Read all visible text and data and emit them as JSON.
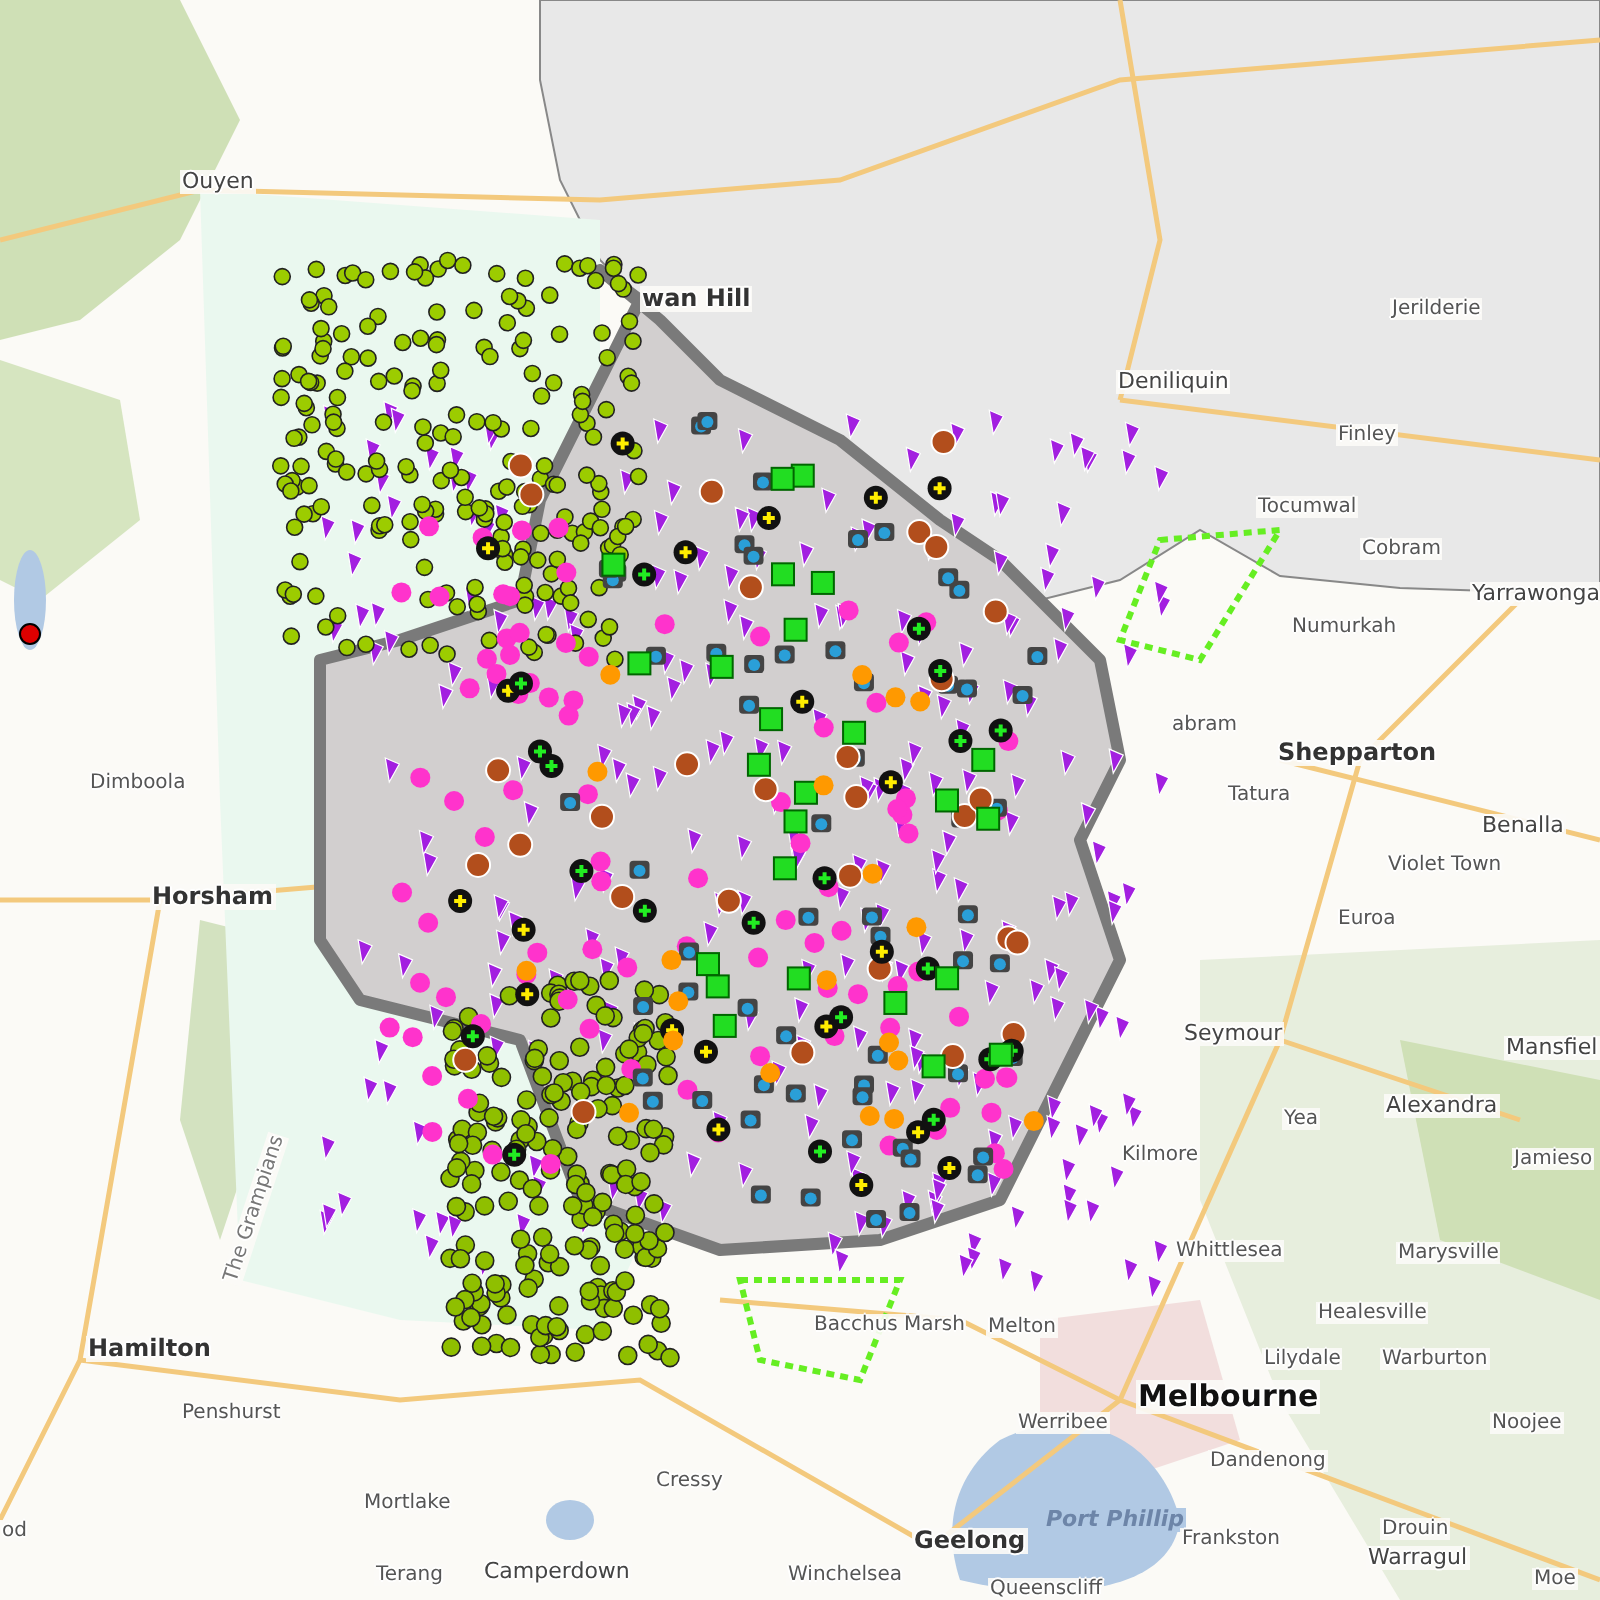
{
  "map": {
    "places": [
      {
        "name": "Ouyen",
        "kind": "town"
      },
      {
        "name": "wan Hill",
        "kind": "city"
      },
      {
        "name": "Deniliquin",
        "kind": "town"
      },
      {
        "name": "Jerilderie",
        "kind": "small"
      },
      {
        "name": "Finley",
        "kind": "small"
      },
      {
        "name": "Tocumwal",
        "kind": "small"
      },
      {
        "name": "Cobram",
        "kind": "small"
      },
      {
        "name": "Yarrawonga",
        "kind": "town"
      },
      {
        "name": "Numurkah",
        "kind": "small"
      },
      {
        "name": "abram",
        "kind": "small"
      },
      {
        "name": "Shepparton",
        "kind": "city"
      },
      {
        "name": "Tatura",
        "kind": "small"
      },
      {
        "name": "Benalla",
        "kind": "town"
      },
      {
        "name": "Violet Town",
        "kind": "small"
      },
      {
        "name": "Euroa",
        "kind": "small"
      },
      {
        "name": "Seymour",
        "kind": "town"
      },
      {
        "name": "Mansfiel",
        "kind": "town"
      },
      {
        "name": "Alexandra",
        "kind": "town"
      },
      {
        "name": "Yea",
        "kind": "small"
      },
      {
        "name": "Jamieso",
        "kind": "small"
      },
      {
        "name": "Kilmore",
        "kind": "small"
      },
      {
        "name": "Whittlesea",
        "kind": "small"
      },
      {
        "name": "Marysville",
        "kind": "small"
      },
      {
        "name": "Healesville",
        "kind": "small"
      },
      {
        "name": "Bacchus Marsh",
        "kind": "small"
      },
      {
        "name": "Melton",
        "kind": "small"
      },
      {
        "name": "Lilydale",
        "kind": "small"
      },
      {
        "name": "Warburton",
        "kind": "small"
      },
      {
        "name": "Melbourne",
        "kind": "major"
      },
      {
        "name": "Noojee",
        "kind": "small"
      },
      {
        "name": "Werribee",
        "kind": "small"
      },
      {
        "name": "Dandenong",
        "kind": "small"
      },
      {
        "name": "Port Phillip",
        "kind": "water"
      },
      {
        "name": "Drouin",
        "kind": "small"
      },
      {
        "name": "Geelong",
        "kind": "city"
      },
      {
        "name": "Frankston",
        "kind": "small"
      },
      {
        "name": "Warragul",
        "kind": "town"
      },
      {
        "name": "Winchelsea",
        "kind": "small"
      },
      {
        "name": "Moe",
        "kind": "small"
      },
      {
        "name": "Queenscliff",
        "kind": "small"
      },
      {
        "name": "Dimboola",
        "kind": "small"
      },
      {
        "name": "Horsham",
        "kind": "city"
      },
      {
        "name": "Hamilton",
        "kind": "city"
      },
      {
        "name": "Penshurst",
        "kind": "small"
      },
      {
        "name": "The Grampians",
        "kind": "range"
      },
      {
        "name": "Mortlake",
        "kind": "small"
      },
      {
        "name": "Terang",
        "kind": "small"
      },
      {
        "name": "Camperdown",
        "kind": "town"
      },
      {
        "name": "Cressy",
        "kind": "small"
      },
      {
        "name": "od",
        "kind": "small"
      }
    ]
  }
}
